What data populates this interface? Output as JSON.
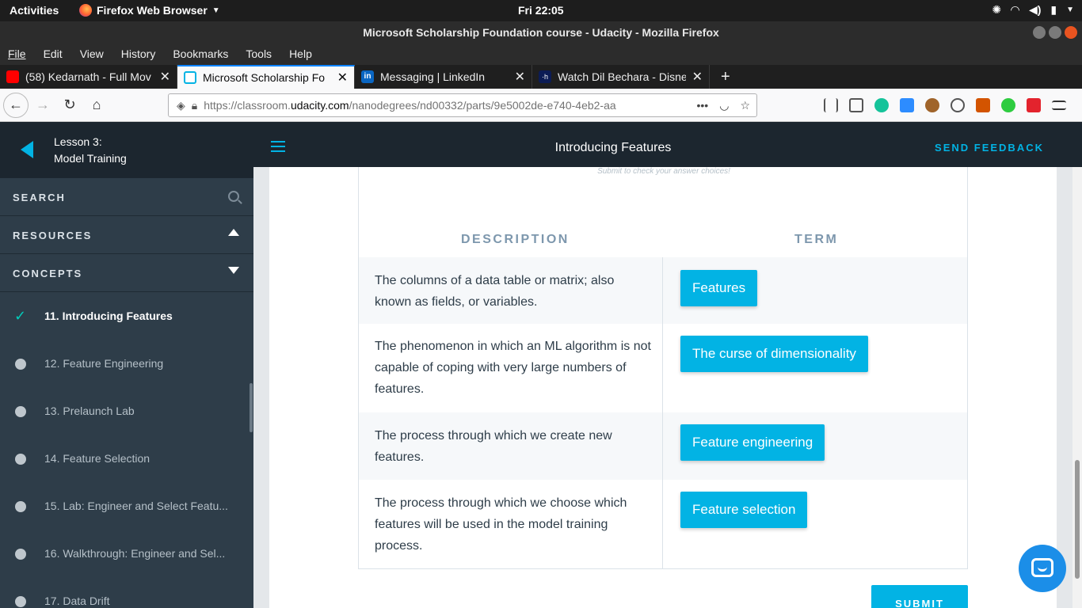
{
  "system": {
    "activities": "Activities",
    "app_name": "Firefox Web Browser",
    "clock": "Fri 22:05"
  },
  "window": {
    "title": "Microsoft Scholarship Foundation course - Udacity - Mozilla Firefox"
  },
  "menu": [
    "File",
    "Edit",
    "View",
    "History",
    "Bookmarks",
    "Tools",
    "Help"
  ],
  "tabs": [
    {
      "label": "(58) Kedarnath - Full Mov",
      "favicon": "youtube-icon",
      "active": false
    },
    {
      "label": "Microsoft Scholarship Fo",
      "favicon": "udacity-icon",
      "active": true
    },
    {
      "label": "Messaging | LinkedIn",
      "favicon": "linkedin-icon",
      "active": false
    },
    {
      "label": "Watch Dil Bechara - Disne",
      "favicon": "hotstar-icon",
      "active": false
    }
  ],
  "url": {
    "prefix": "https://classroom.",
    "domain": "udacity.com",
    "path": "/nanodegrees/nd00332/parts/9e5002de-e740-4eb2-aa"
  },
  "sidebar": {
    "lesson_line1": "Lesson 3:",
    "lesson_line2": "Model Training",
    "search": "SEARCH",
    "resources": "RESOURCES",
    "concepts": "CONCEPTS",
    "concept_items": [
      {
        "label": "11. Introducing Features",
        "done": true
      },
      {
        "label": "12. Feature Engineering",
        "done": false
      },
      {
        "label": "13. Prelaunch Lab",
        "done": false
      },
      {
        "label": "14. Feature Selection",
        "done": false
      },
      {
        "label": "15. Lab: Engineer and Select Featu...",
        "done": false
      },
      {
        "label": "16. Walkthrough: Engineer and Sel...",
        "done": false
      },
      {
        "label": "17. Data Drift",
        "done": false
      }
    ]
  },
  "header": {
    "title": "Introducing Features",
    "feedback": "SEND FEEDBACK"
  },
  "quiz": {
    "hint": "Submit to check your answer choices!",
    "col_description": "DESCRIPTION",
    "col_term": "TERM",
    "rows": [
      {
        "description": "The columns of a data table or matrix; also known as fields, or variables.",
        "term": "Features"
      },
      {
        "description": "The phenomenon in which an ML algorithm is not capable of coping with very large numbers of features.",
        "term": "The curse of dimensionality"
      },
      {
        "description": "The process through which we create new features.",
        "term": "Feature engineering"
      },
      {
        "description": "The process through which we choose which features will be used in the model training process.",
        "term": "Feature selection"
      }
    ],
    "submit": "SUBMIT"
  },
  "colors": {
    "accent": "#02b3e4",
    "sidebar_bg": "#2e3d49",
    "header_bg": "#1c262f",
    "check": "#02ccba"
  }
}
